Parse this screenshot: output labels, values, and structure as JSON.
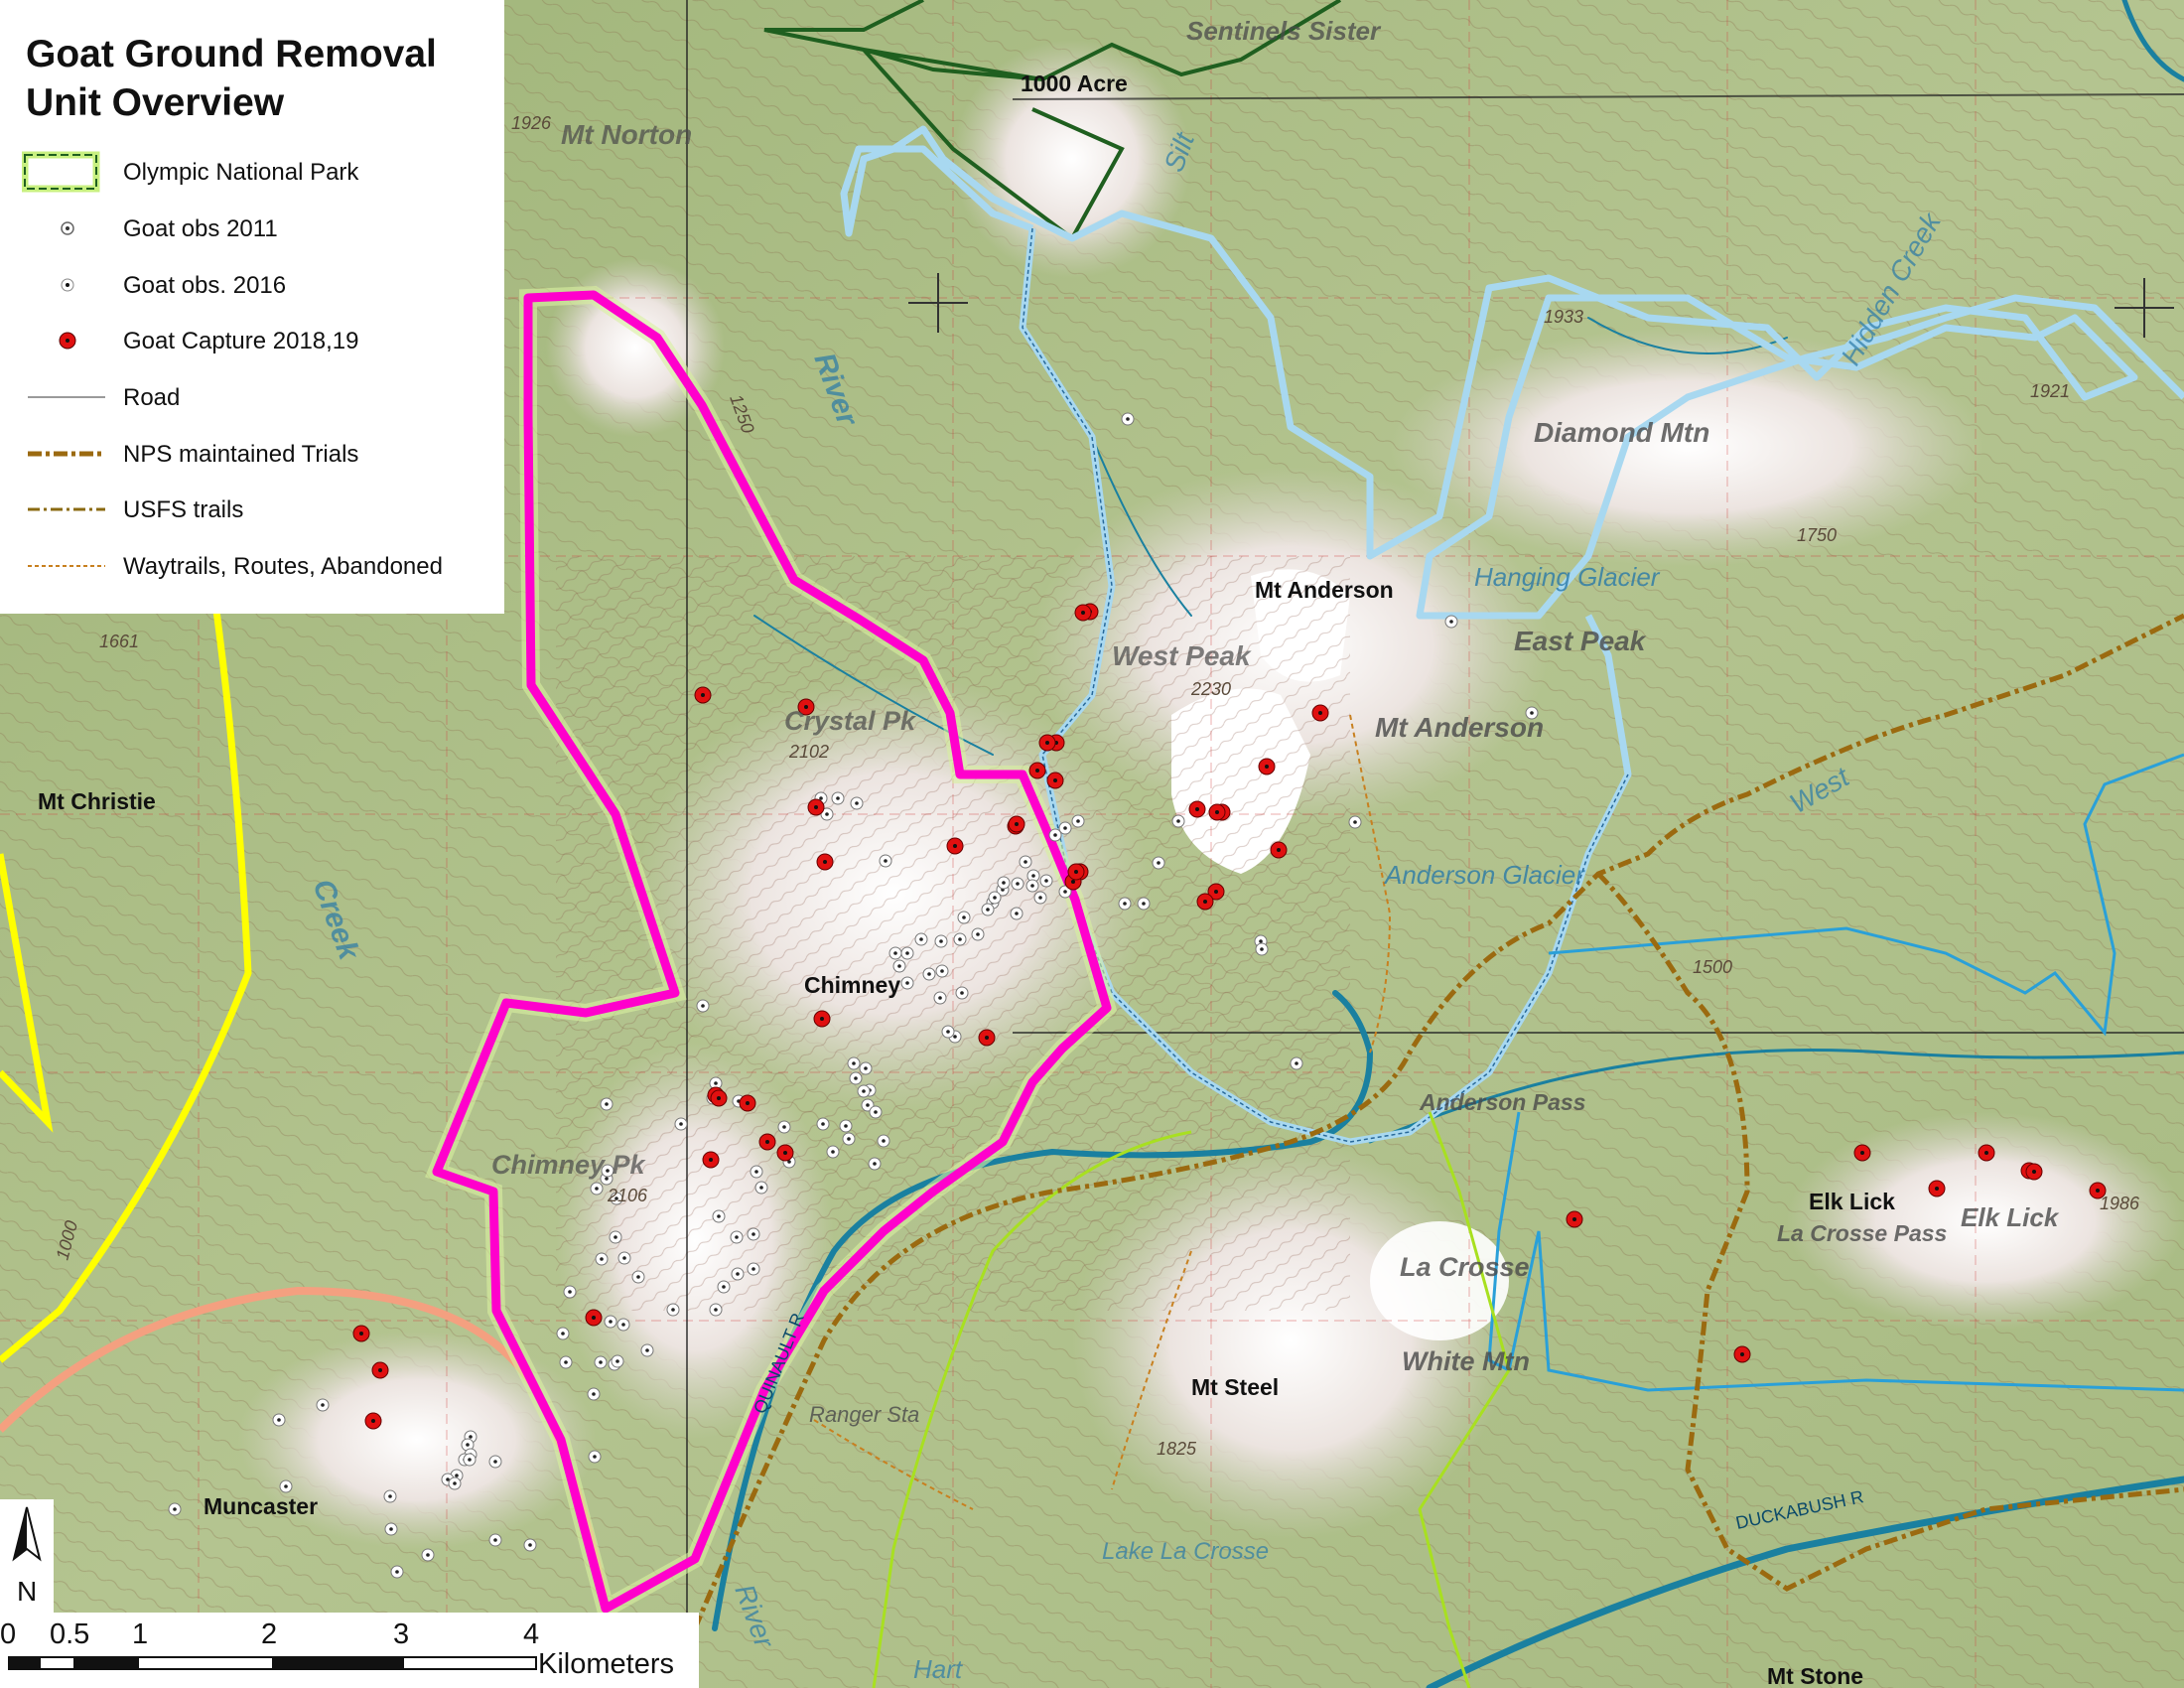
{
  "legend": {
    "title_line1": "Goat Ground Removal",
    "title_line2": "Unit Overview",
    "items": [
      {
        "label": "Olympic National Park",
        "symbol": "park-boundary-icon"
      },
      {
        "label": "Goat obs 2011",
        "symbol": "goat-obs-2011-icon"
      },
      {
        "label": "Goat obs. 2016",
        "symbol": "goat-obs-2016-icon"
      },
      {
        "label": "Goat Capture 2018,19",
        "symbol": "goat-capture-icon"
      },
      {
        "label": "Road",
        "symbol": "road-line-icon"
      },
      {
        "label": "NPS maintained Trials",
        "symbol": "nps-trail-icon"
      },
      {
        "label": "USFS trails",
        "symbol": "usfs-trail-icon"
      },
      {
        "label": "Waytrails, Routes, Abandoned",
        "symbol": "waytrail-icon"
      }
    ]
  },
  "place_labels": {
    "sentinels_sister": "Sentinels Sister",
    "acre_1000": "1000 Acre",
    "mt_norton": "Mt Norton",
    "mt_anderson": "Mt Anderson",
    "mt_anderson_2": "Mt Anderson",
    "diamond_mtn": "Diamond Mtn",
    "east_peak": "East Peak",
    "hanging_glacier": "Hanging Glacier",
    "west_peak": "West Peak",
    "crystal_pk": "Crystal Pk",
    "chimney": "Chimney",
    "chimney_pk": "Chimney Pk",
    "mt_christie": "Mt Christie",
    "anderson_glacier": "Anderson Glacier",
    "anderson_pass": "Anderson Pass",
    "elk_lick": "Elk Lick",
    "elk_lick_2": "Elk Lick",
    "la_crosse_pass": "La Crosse Pass",
    "la_crosse": "La Crosse",
    "white_mtn": "White Mtn",
    "mt_steel": "Mt Steel",
    "lake_la_crosse": "Lake La Crosse",
    "muncaster": "Muncaster",
    "mt_stone": "Mt Stone",
    "ranger_sta": "Ranger Sta",
    "quinault_r": "QUINAULT R",
    "duckabush_r": "DUCKABUSH R",
    "river": "River",
    "creek": "Creek",
    "silt": "Silt",
    "west_fork": "West",
    "hidden_creek": "Hidden Creek",
    "river_lower": "River",
    "hart": "Hart"
  },
  "elevations": [
    "1926",
    "1933",
    "1921",
    "1661",
    "2102",
    "2106",
    "1825",
    "1986",
    "2230",
    "1250",
    "1750",
    "1500",
    "1000"
  ],
  "north_arrow": {
    "letter": "N"
  },
  "scale_bar": {
    "ticks": [
      "0",
      "0.5",
      "1",
      "2",
      "3",
      "4"
    ],
    "unit": "Kilometers"
  },
  "colors": {
    "park_boundary": "#ff00cc",
    "park_halo": "#d8f0a0",
    "glacier_outline": "#a8d8f0",
    "yellow_unit": "#ffff00",
    "green_boundary": "#1f5f1f",
    "salmon_boundary": "#f4a080",
    "river": "#1a80a0",
    "nps_trail": "#9b6a10",
    "blue_line": "#2aa0d8",
    "lime_line": "#a8e020",
    "capture": "#e01010"
  },
  "goat_capture_points": 44,
  "goat_obs_points": 98
}
